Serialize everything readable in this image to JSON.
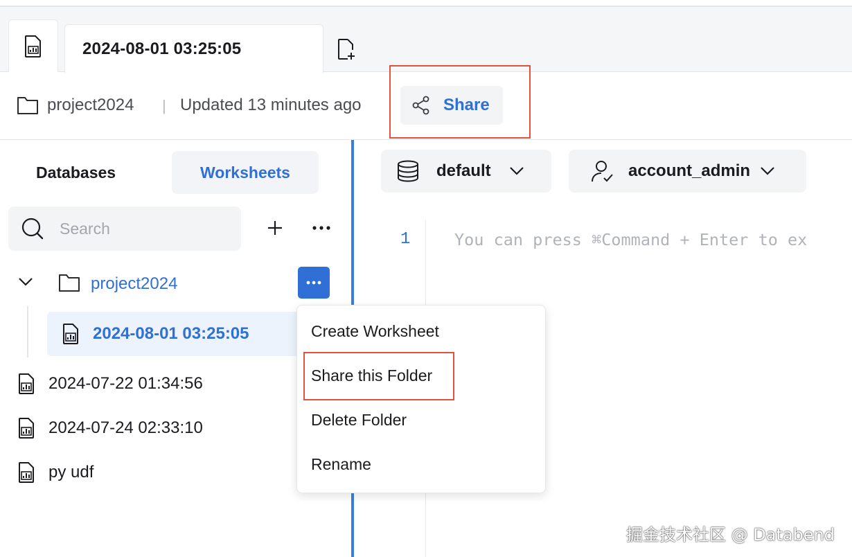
{
  "tabs": {
    "active_title": "2024-08-01 03:25:05"
  },
  "info": {
    "folder": "project2024",
    "separator": "|",
    "updated": "Updated 13 minutes ago",
    "share_label": "Share"
  },
  "sidebar": {
    "tab_databases": "Databases",
    "tab_worksheets": "Worksheets",
    "search_placeholder": "Search",
    "folder_label": "project2024",
    "selected_worksheet": "2024-08-01 03:25:05",
    "items": [
      {
        "label": "2024-07-22 01:34:56"
      },
      {
        "label": "2024-07-24 02:33:10"
      },
      {
        "label": "py udf"
      }
    ]
  },
  "editor": {
    "database": "default",
    "role": "account_admin",
    "line_number": "1",
    "placeholder": "You can press ⌘Command + Enter to ex"
  },
  "context_menu": {
    "items": [
      "Create Worksheet",
      "Share this Folder",
      "Delete Folder",
      "Rename"
    ]
  },
  "watermark": "掘金技术社区 @ Databend",
  "colors": {
    "accent": "#2f6fd6",
    "highlight": "#e0523b"
  }
}
